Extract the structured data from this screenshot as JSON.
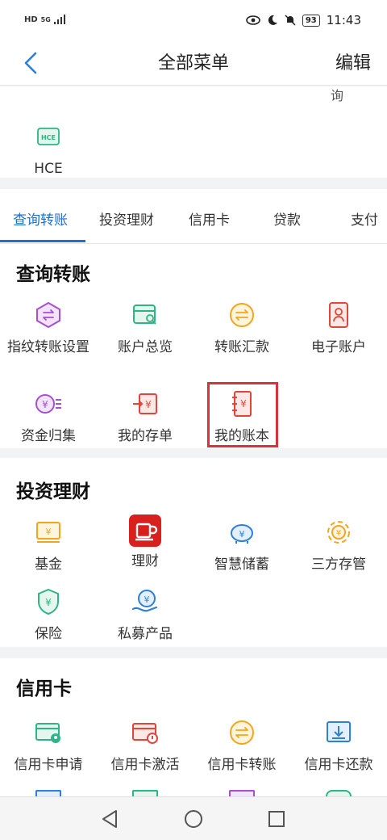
{
  "status_bar": {
    "network": "HD",
    "signal_label": "5G",
    "battery": "93",
    "time": "11:43"
  },
  "header": {
    "title": "全部菜单",
    "edit_label": "编辑"
  },
  "prev_section": {
    "cut_label": "询",
    "items": [
      {
        "label": "HCE",
        "icon": "hce-icon"
      }
    ]
  },
  "tabs": [
    {
      "label": "查询转账",
      "active": true
    },
    {
      "label": "投资理财"
    },
    {
      "label": "信用卡"
    },
    {
      "label": "贷款"
    },
    {
      "label": "支付"
    }
  ],
  "sections": {
    "query_transfer": {
      "title": "查询转账",
      "items": [
        {
          "label": "指纹转账设置",
          "icon": "fingerprint-transfer-icon"
        },
        {
          "label": "账户总览",
          "icon": "account-overview-icon"
        },
        {
          "label": "转账汇款",
          "icon": "transfer-icon"
        },
        {
          "label": "电子账户",
          "icon": "e-account-icon"
        },
        {
          "label": "资金归集",
          "icon": "fund-collection-icon"
        },
        {
          "label": "我的存单",
          "icon": "deposit-icon"
        },
        {
          "label": "我的账本",
          "icon": "ledger-icon"
        }
      ]
    },
    "investment": {
      "title": "投资理财",
      "items": [
        {
          "label": "基金",
          "icon": "fund-icon"
        },
        {
          "label": "理财",
          "icon": "wealth-icon"
        },
        {
          "label": "智慧储蓄",
          "icon": "piggy-bank-icon"
        },
        {
          "label": "三方存管",
          "icon": "third-party-icon"
        },
        {
          "label": "保险",
          "icon": "insurance-icon"
        },
        {
          "label": "私募产品",
          "icon": "private-fund-icon"
        }
      ]
    },
    "credit_card": {
      "title": "信用卡",
      "items": [
        {
          "label": "信用卡申请",
          "icon": "card-apply-icon"
        },
        {
          "label": "信用卡激活",
          "icon": "card-activate-icon"
        },
        {
          "label": "信用卡转账",
          "icon": "card-transfer-icon"
        },
        {
          "label": "信用卡还款",
          "icon": "card-repay-icon"
        }
      ]
    }
  },
  "colors": {
    "accent": "#1e6fd0",
    "highlight": "#d8323c",
    "purple": "#a64fd1",
    "green": "#2eb487",
    "orange": "#f3a51d",
    "red": "#e0473b",
    "blue": "#2e7fd9"
  }
}
